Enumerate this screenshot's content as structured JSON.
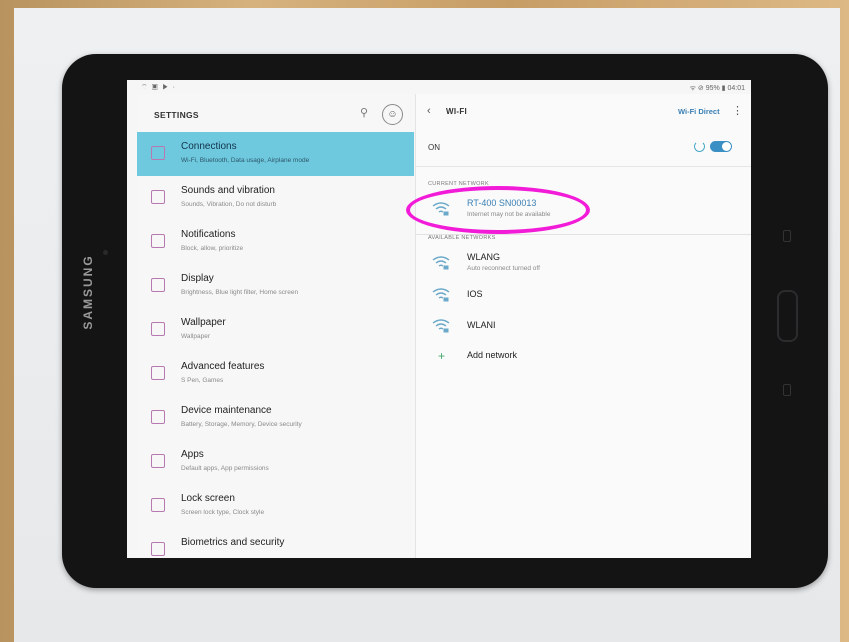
{
  "device": {
    "brand": "SAMSUNG"
  },
  "statusbar": {
    "left_icons": "⌔ ▣ ▶ ·",
    "right_text": "ᯤ ⊘ 95% ▮ 04:01"
  },
  "settings": {
    "title": "SETTINGS",
    "items": [
      {
        "title": "Connections",
        "subtitle": "Wi-Fi, Bluetooth, Data usage, Airplane mode",
        "active": true
      },
      {
        "title": "Sounds and vibration",
        "subtitle": "Sounds, Vibration, Do not disturb"
      },
      {
        "title": "Notifications",
        "subtitle": "Block, allow, prioritize"
      },
      {
        "title": "Display",
        "subtitle": "Brightness, Blue light filter, Home screen"
      },
      {
        "title": "Wallpaper",
        "subtitle": "Wallpaper"
      },
      {
        "title": "Advanced features",
        "subtitle": "S Pen, Games"
      },
      {
        "title": "Device maintenance",
        "subtitle": "Battery, Storage, Memory, Device security"
      },
      {
        "title": "Apps",
        "subtitle": "Default apps, App permissions"
      },
      {
        "title": "Lock screen",
        "subtitle": "Screen lock type, Clock style"
      },
      {
        "title": "Biometrics and security",
        "subtitle": ""
      }
    ]
  },
  "wifi": {
    "title": "WI-FI",
    "wifi_direct": "Wi-Fi Direct",
    "on_label": "ON",
    "current_label": "CURRENT NETWORK",
    "current": {
      "name": "RT-400 SN00013",
      "status": "Internet may not be available"
    },
    "available_label": "AVAILABLE NETWORKS",
    "networks": [
      {
        "name": "WLANG",
        "status": "Auto reconnect turned off"
      },
      {
        "name": "IOS",
        "status": ""
      },
      {
        "name": "WLANI",
        "status": ""
      }
    ],
    "add_network": "Add network"
  },
  "colors": {
    "active_item": "#6ec9df",
    "highlight_ring": "#f21cd8",
    "accent": "#3a7fb4"
  }
}
